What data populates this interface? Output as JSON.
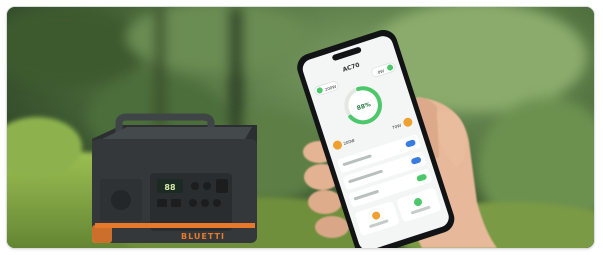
{
  "product_photo": {
    "power_station": {
      "brand_text": "BLUETTI",
      "display_reading": "88",
      "accent_color": "#e8792b",
      "body_color": "#34383a"
    },
    "phone_app": {
      "header_title": "AC70",
      "battery_percent": "88%",
      "stat_left": "200W",
      "stat_right": "0W",
      "in_left": "200W",
      "in_right": "70W",
      "accent_green": "#4cc76a",
      "accent_orange": "#f0a030",
      "accent_blue": "#3a7de0"
    },
    "background": {
      "foliage_color": "#4f7a3f",
      "moss_color": "#8fb44a"
    }
  }
}
